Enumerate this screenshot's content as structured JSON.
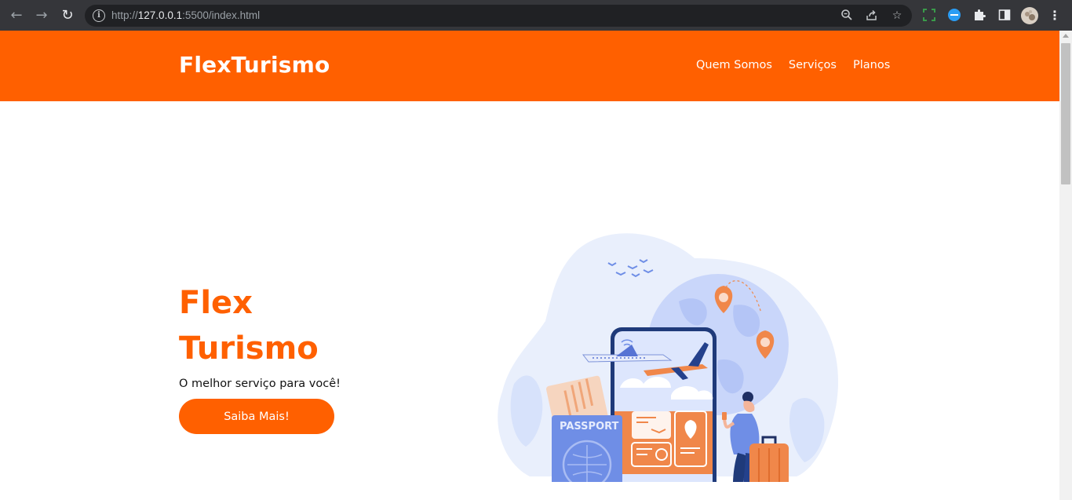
{
  "browser": {
    "url_scheme": "http://",
    "url_host": "127.0.0.1",
    "url_rest": ":5500/index.html",
    "icons": [
      "back-icon",
      "forward-icon",
      "reload-icon",
      "info-icon",
      "zoom-icon",
      "share-icon",
      "star-icon",
      "extension-screen-icon",
      "extension-blue-icon",
      "puzzle-icon",
      "sidebar-icon",
      "profile-avatar",
      "menu-kebab-icon"
    ]
  },
  "header": {
    "brand": "FlexTurismo",
    "menu": [
      "Quem Somos",
      "Serviços",
      "Planos"
    ]
  },
  "hero": {
    "title_line1": "Flex",
    "title_line2": "Turismo",
    "subtitle": "O melhor serviço para você!",
    "cta_label": "Saiba Mais!"
  },
  "illustration": {
    "passport_label": "PASSPORT"
  },
  "colors": {
    "brand_orange": "#ff6000",
    "chrome_dark": "#35363a",
    "omnibox": "#202124"
  }
}
